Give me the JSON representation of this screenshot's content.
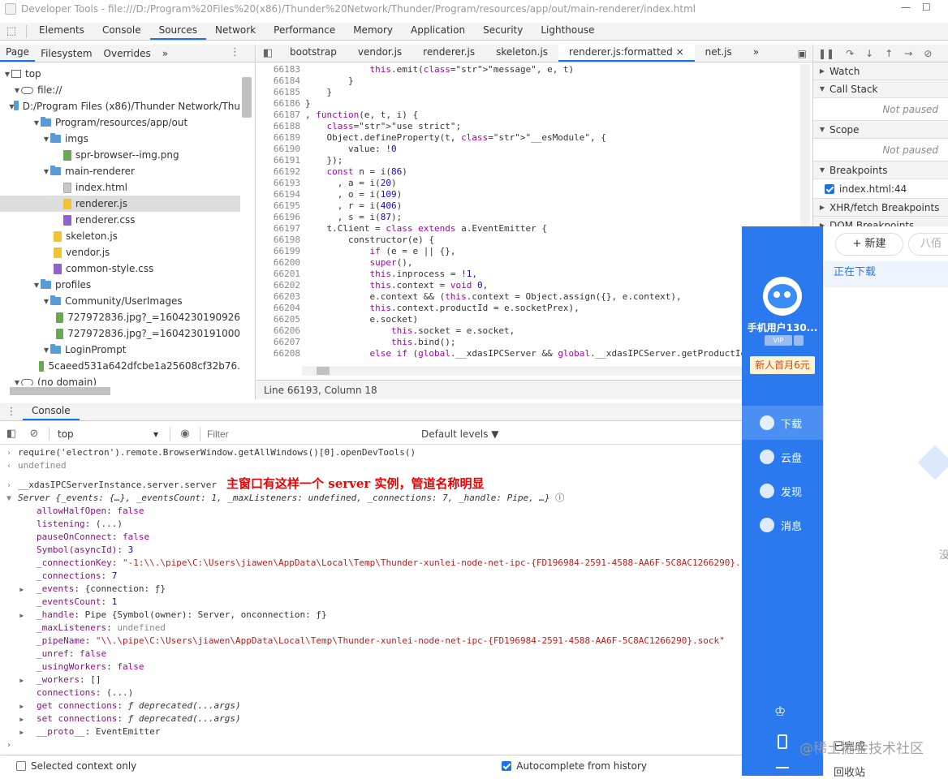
{
  "window": {
    "title": "Developer Tools - file:///D:/Program%20Files%20(x86)/Thunder%20Network/Thunder/Program/resources/app/out/main-renderer/index.html",
    "minimize": "—",
    "maximize": "☐"
  },
  "main_tabs": [
    "Elements",
    "Console",
    "Sources",
    "Network",
    "Performance",
    "Memory",
    "Application",
    "Security",
    "Lighthouse"
  ],
  "active_main_tab": "Sources",
  "left_tabs": [
    "Page",
    "Filesystem",
    "Overrides",
    "»"
  ],
  "file_tree": [
    {
      "label": "top",
      "depth": 0,
      "kind": "top",
      "open": true
    },
    {
      "label": "file://",
      "depth": 1,
      "kind": "cloud",
      "open": true
    },
    {
      "label": "D:/Program Files (x86)/Thunder Network/Thu",
      "depth": 2,
      "kind": "folder",
      "open": true
    },
    {
      "label": "Program/resources/app/out",
      "depth": 3,
      "kind": "folder",
      "open": true
    },
    {
      "label": "imgs",
      "depth": 4,
      "kind": "folder",
      "open": true
    },
    {
      "label": "spr-browser--img.png",
      "depth": 5,
      "kind": "img"
    },
    {
      "label": "main-renderer",
      "depth": 4,
      "kind": "folder",
      "open": true
    },
    {
      "label": "index.html",
      "depth": 5,
      "kind": "html"
    },
    {
      "label": "renderer.js",
      "depth": 5,
      "kind": "js",
      "selected": true
    },
    {
      "label": "renderer.css",
      "depth": 5,
      "kind": "css"
    },
    {
      "label": "skeleton.js",
      "depth": 4,
      "kind": "js"
    },
    {
      "label": "vendor.js",
      "depth": 4,
      "kind": "js"
    },
    {
      "label": "common-style.css",
      "depth": 4,
      "kind": "css"
    },
    {
      "label": "profiles",
      "depth": 3,
      "kind": "folder",
      "open": true
    },
    {
      "label": "Community/UserImages",
      "depth": 4,
      "kind": "folder",
      "open": true
    },
    {
      "label": "727972836.jpg?_=1604230190926",
      "depth": 5,
      "kind": "img"
    },
    {
      "label": "727972836.jpg?_=1604230191000",
      "depth": 5,
      "kind": "img"
    },
    {
      "label": "LoginPrompt",
      "depth": 4,
      "kind": "folder",
      "open": true
    },
    {
      "label": "5caeed531a642dfcbe1a25608cf32b76.",
      "depth": 5,
      "kind": "img"
    },
    {
      "label": "(no domain)",
      "depth": 1,
      "kind": "cloud",
      "open": true
    }
  ],
  "editor_tabs": [
    "bootstrap",
    "vendor.js",
    "renderer.js",
    "skeleton.js",
    "renderer.js:formatted",
    "net.js",
    "»"
  ],
  "active_editor_tab": "renderer.js:formatted",
  "gutter_start": 66183,
  "code_lines": [
    "            this.emit(\"message\", e, t)",
    "        }",
    "    }",
    "}",
    ", function(e, t, i) {",
    "    \"use strict\";",
    "    Object.defineProperty(t, \"__esModule\", {",
    "        value: !0",
    "    });",
    "    const n = i(86)",
    "      , a = i(20)",
    "      , o = i(109)",
    "      , r = i(406)",
    "      , s = i(87);",
    "    t.Client = class extends a.EventEmitter {",
    "        constructor(e) {",
    "            if (e = e || {},",
    "            super(),",
    "            this.inprocess = !1,",
    "            this.context = void 0,",
    "            e.context && (this.context = Object.assign({}, e.context),",
    "            this.context.productId = e.socketPrex),",
    "            e.socket)",
    "                this.socket = e.socket,",
    "                this.bind();",
    "            else if (global.__xdasIPCServer && global.__xdasIPCServer.getProductIo",
    "                this.inprocess = !0,"
  ],
  "editor_status": "Line 66193, Column 18",
  "debugger": {
    "sections": [
      {
        "label": "Watch",
        "open": false
      },
      {
        "label": "Call Stack",
        "open": true,
        "note": "Not paused"
      },
      {
        "label": "Scope",
        "open": true,
        "note": "Not paused"
      },
      {
        "label": "Breakpoints",
        "open": true
      },
      {
        "label": "XHR/fetch Breakpoints",
        "open": false
      },
      {
        "label": "DOM Breakpoints",
        "open": false
      }
    ],
    "breakpoint_item": "index.html:44"
  },
  "drawer_tab": "Console",
  "console_toolbar": {
    "context": "top",
    "filter_placeholder": "Filter",
    "levels": "Default levels ▼"
  },
  "console": {
    "cmd1": "require('electron').remote.BrowserWindow.getAllWindows()[0].openDevTools()",
    "res1": "undefined",
    "cmd2": "__xdasIPCServerInstance.server.server",
    "annotation": "主窗口有这样一个 server 实例，管道名称明显",
    "server_header": "Server {_events: {…}, _eventsCount: 1, _maxListeners: undefined, _connections: 7, _handle: Pipe, …}",
    "props": [
      {
        "k": "allowHalfOpen",
        "v": "false",
        "t": "kw"
      },
      {
        "k": "listening",
        "v": "(...)",
        "t": "plain"
      },
      {
        "k": "pauseOnConnect",
        "v": "false",
        "t": "kw"
      },
      {
        "k": "Symbol(asyncId)",
        "v": "3",
        "t": "num"
      },
      {
        "k": "_connectionKey",
        "v": "\"-1:\\\\.\\pipe\\C:\\Users\\jiawen\\AppData\\Local\\Temp\\Thunder-xunlei-node-net-ipc-{FD196984-2591-4588-AA6F-5C8AC1266290}.sock\"",
        "t": "str"
      },
      {
        "k": "_connections",
        "v": "7",
        "t": "num"
      },
      {
        "k": "_events",
        "v": "{connection: ƒ}",
        "t": "plain",
        "tw": true
      },
      {
        "k": "_eventsCount",
        "v": "1",
        "t": "num"
      },
      {
        "k": "_handle",
        "v": "Pipe {Symbol(owner): Server, onconnection: ƒ}",
        "t": "plain",
        "tw": true
      },
      {
        "k": "_maxListeners",
        "v": "undefined",
        "t": "dim"
      },
      {
        "k": "_pipeName",
        "v": "\"\\\\.\\pipe\\C:\\Users\\jiawen\\AppData\\Local\\Temp\\Thunder-xunlei-node-net-ipc-{FD196984-2591-4588-AA6F-5C8AC1266290}.sock\"",
        "t": "str"
      },
      {
        "k": "_unref",
        "v": "false",
        "t": "kw"
      },
      {
        "k": "_usingWorkers",
        "v": "false",
        "t": "kw"
      },
      {
        "k": "_workers",
        "v": "[]",
        "t": "plain",
        "tw": true
      },
      {
        "k": "connections",
        "v": "(...)",
        "t": "plain"
      },
      {
        "k": "get connections",
        "v": "ƒ deprecated(...args)",
        "t": "ital",
        "tw": true
      },
      {
        "k": "set connections",
        "v": "ƒ deprecated(...args)",
        "t": "ital",
        "tw": true
      },
      {
        "k": "__proto__",
        "v": "EventEmitter",
        "t": "plain",
        "tw": true
      }
    ]
  },
  "console_footer": {
    "selected_context": "Selected context only",
    "autocomplete": "Autocomplete from history"
  },
  "thunder": {
    "username": "手机用户130...",
    "vip": "VIP",
    "promo": "新人首月6元",
    "nav": [
      "下载",
      "云盘",
      "发现",
      "消息"
    ],
    "new_button": "+ 新建",
    "tab2": "八佰",
    "downloading": "正在下载",
    "empty": "没",
    "completed": "已完成",
    "recycle": "回收站"
  },
  "watermark": "@稀土掘金技术社区",
  "colors": {
    "accent": "#1a73e8",
    "thunder_blue": "#2a79ee",
    "annotation": "#e00000"
  }
}
